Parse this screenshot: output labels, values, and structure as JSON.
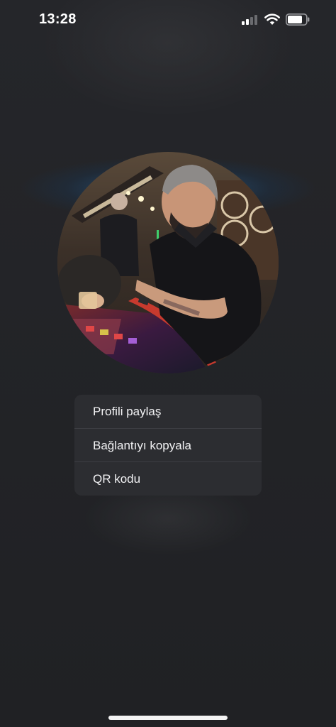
{
  "status_bar": {
    "time": "13:28",
    "signal_icon": "cellular-signal-icon",
    "wifi_icon": "wifi-icon",
    "battery_icon": "battery-icon"
  },
  "profile": {
    "avatar_icon": "profile-photo"
  },
  "menu": {
    "items": [
      {
        "label": "Profili paylaş"
      },
      {
        "label": "Bağlantıyı kopyala"
      },
      {
        "label": "QR kodu"
      }
    ]
  },
  "colors": {
    "background": "#232427",
    "menu_background": "#2c2d31",
    "glow": "#2878be",
    "text": "#f2f2f4"
  }
}
